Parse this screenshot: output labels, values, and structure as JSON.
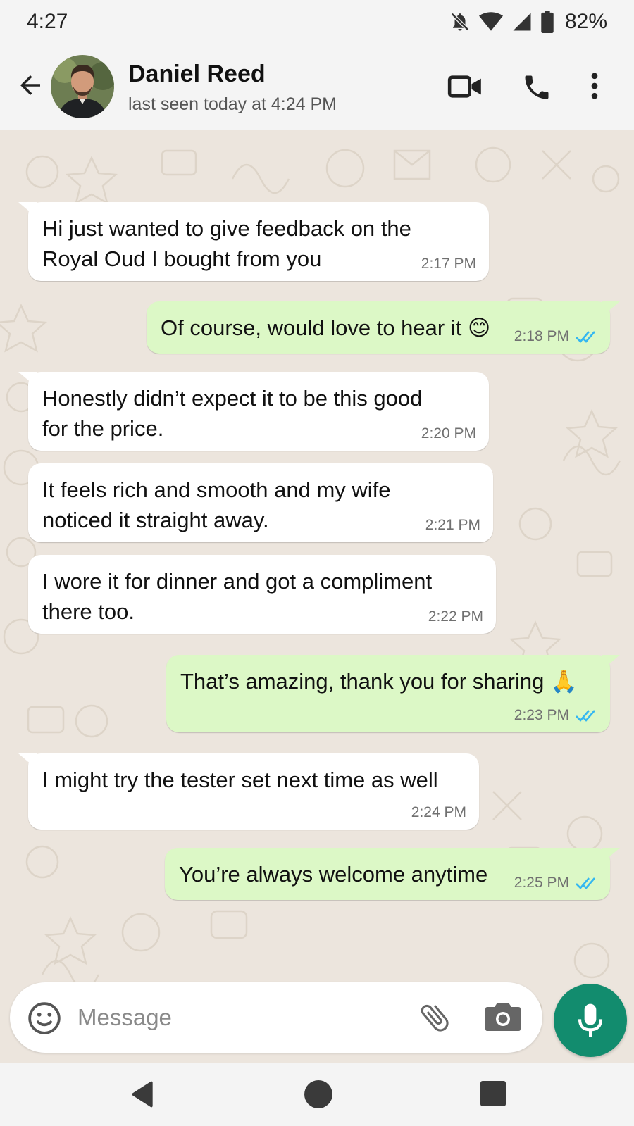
{
  "status_bar": {
    "time": "4:27",
    "battery": "82%",
    "icons": [
      "mute-bell-icon",
      "wifi-icon",
      "signal-icon",
      "battery-icon"
    ]
  },
  "header": {
    "contact_name": "Daniel Reed",
    "last_seen": "last seen today at 4:24 PM",
    "icons": [
      "back-arrow-icon",
      "video-call-icon",
      "phone-icon",
      "more-options-icon"
    ]
  },
  "messages": [
    {
      "direction": "in",
      "lines": [
        "Hi just wanted to give feedback on the",
        "Royal Oud I bought from you"
      ],
      "time": "2:17 PM"
    },
    {
      "direction": "out",
      "lines": [
        "Of course, would love to hear it 😊"
      ],
      "time": "2:18 PM",
      "read": true
    },
    {
      "direction": "in",
      "lines": [
        "Honestly didn’t expect it to be this good",
        "for the price."
      ],
      "time": "2:20 PM"
    },
    {
      "direction": "in",
      "lines": [
        "It feels rich and smooth and my wife",
        "noticed it straight away."
      ],
      "time": "2:21 PM"
    },
    {
      "direction": "in",
      "lines": [
        "I wore it for dinner and got a compliment",
        "there too."
      ],
      "time": "2:22 PM"
    },
    {
      "direction": "out",
      "lines": [
        "That’s amazing, thank you for sharing 🙏"
      ],
      "time": "2:23 PM",
      "read": true
    },
    {
      "direction": "in",
      "lines": [
        "I might try the tester set next time as well"
      ],
      "time": "2:24 PM"
    },
    {
      "direction": "out",
      "lines": [
        "You’re always welcome anytime"
      ],
      "time": "2:25 PM",
      "read": true
    }
  ],
  "input": {
    "placeholder": "Message",
    "value": ""
  },
  "colors": {
    "incoming_bubble": "#ffffff",
    "outgoing_bubble": "#dcf8c6",
    "read_ticks": "#34b7f1",
    "mic_button": "#128c6e",
    "wallpaper": "#ece5dd"
  }
}
